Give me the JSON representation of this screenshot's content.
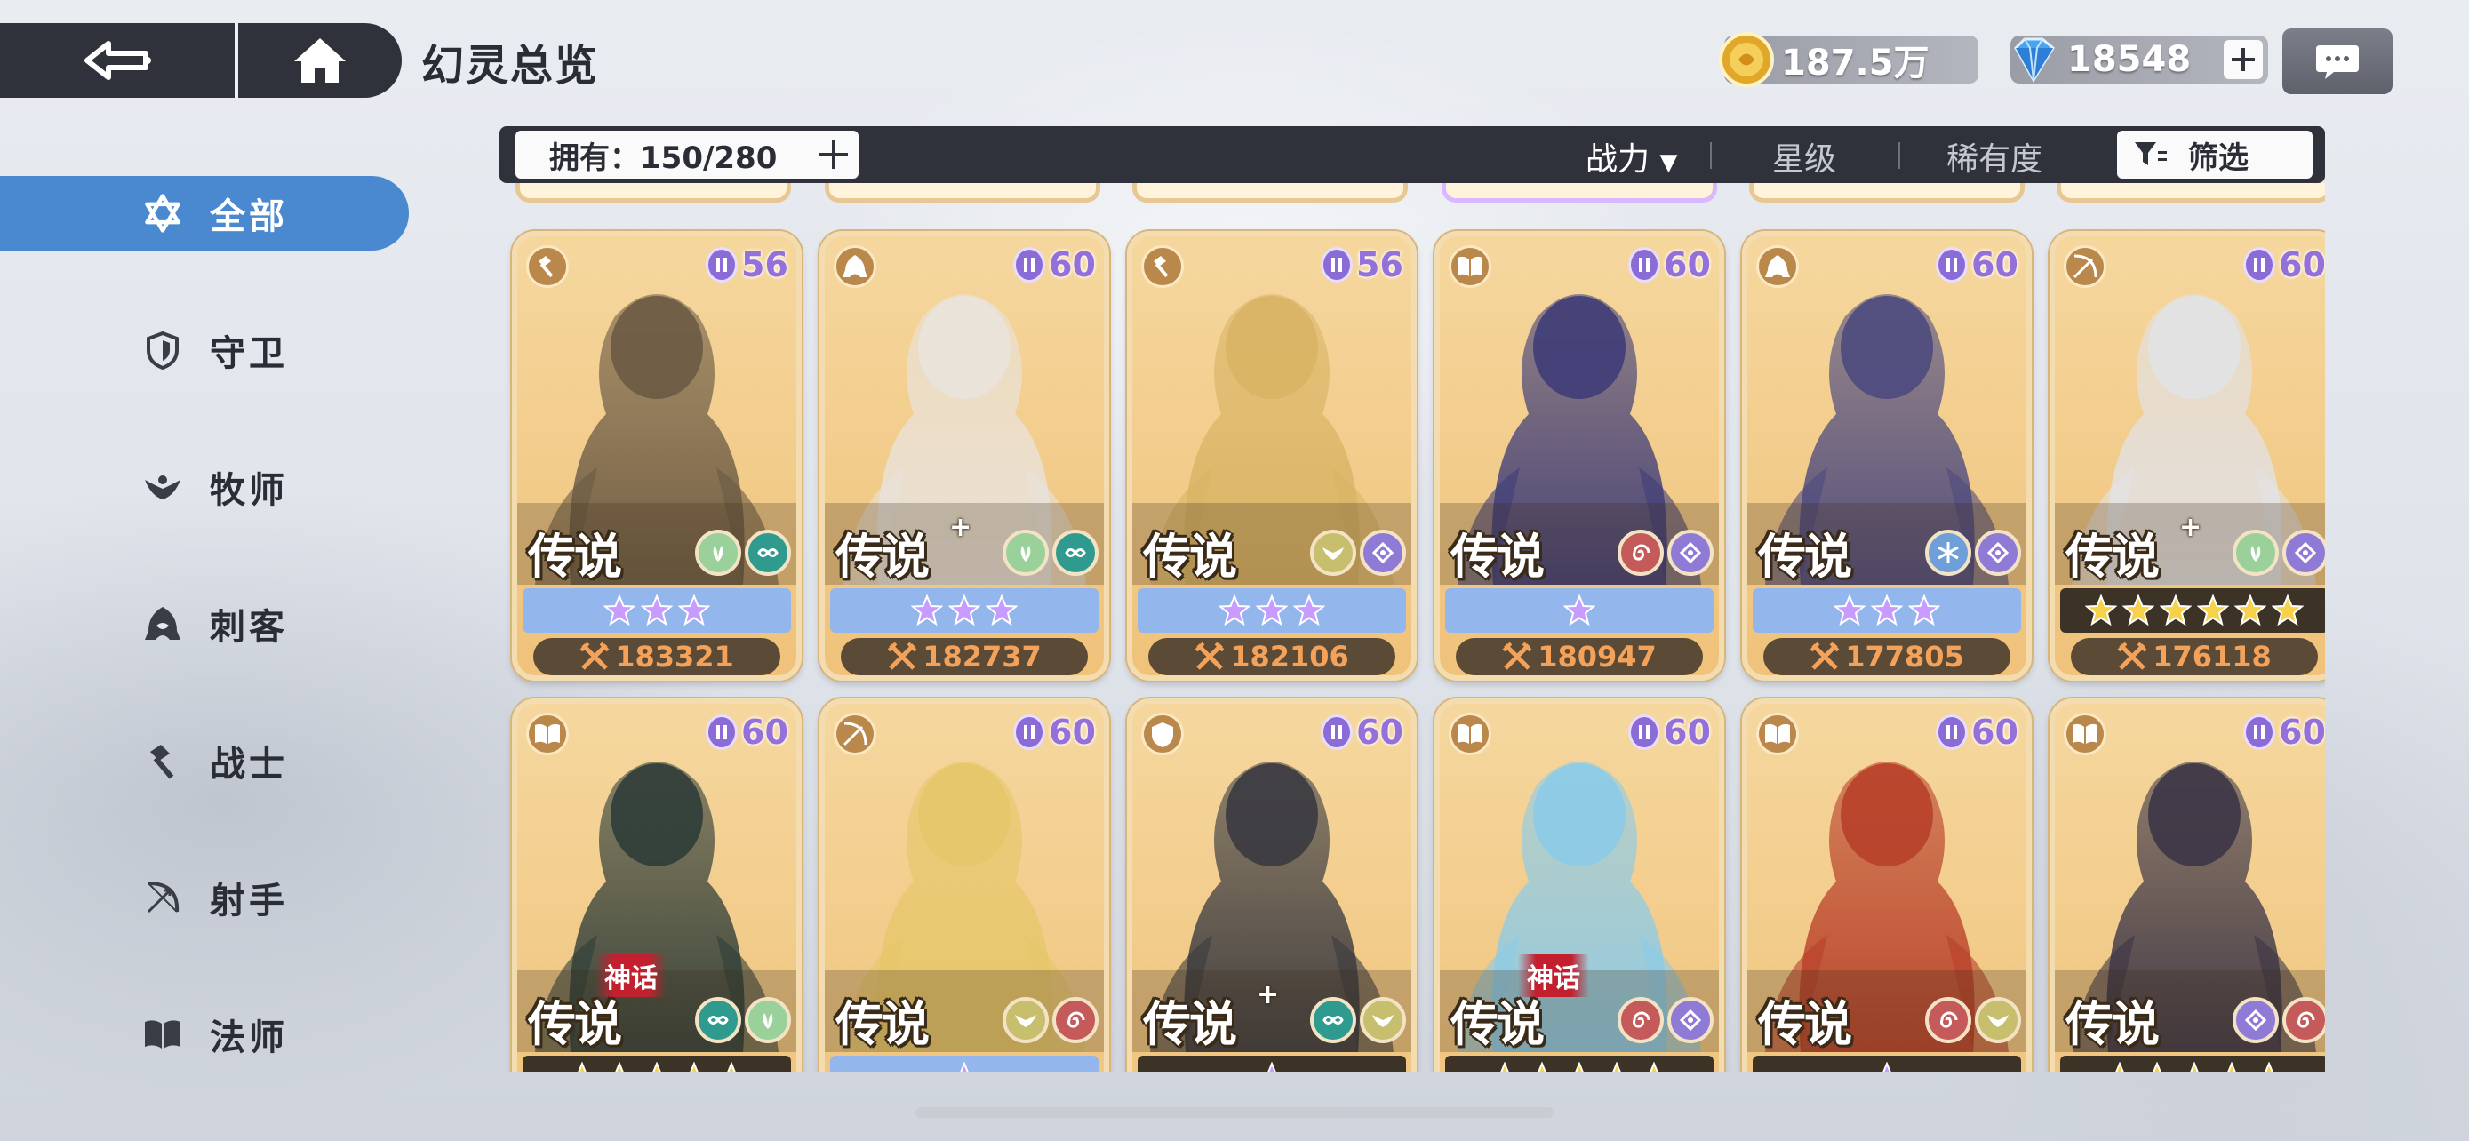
{
  "header": {
    "title": "幻灵总览",
    "back_icon": "back-arrow-icon",
    "home_icon": "home-icon"
  },
  "currency": {
    "gold": "187.5万",
    "gems": "18548"
  },
  "sidebar": {
    "items": [
      {
        "label": "全部",
        "icon": "star-of-david-icon",
        "active": true
      },
      {
        "label": "守卫",
        "icon": "shield-icon"
      },
      {
        "label": "牧师",
        "icon": "wings-icon"
      },
      {
        "label": "刺客",
        "icon": "hood-icon"
      },
      {
        "label": "战士",
        "icon": "hammer-icon"
      },
      {
        "label": "射手",
        "icon": "bow-icon"
      },
      {
        "label": "法师",
        "icon": "book-icon"
      }
    ]
  },
  "filter": {
    "owned": "拥有：150/280",
    "sort_power": "战力",
    "sort_star": "星级",
    "sort_rarity": "稀有度",
    "filter_label": "筛选"
  },
  "colors": {
    "accent_blue": "#4a89cf",
    "bar_dark": "#2f313b",
    "card_gold": "#f0c27a",
    "power_text": "#f4a25a",
    "level_purple": "#9470db"
  },
  "cards": [
    {
      "class": "warrior",
      "level": "56",
      "rarity": "传说",
      "plus": false,
      "myth": "",
      "elements": [
        "lotus",
        "infinity"
      ],
      "band": "blue",
      "stars": 3,
      "star_color": "purple",
      "power": "183321",
      "hue": "#6b5a44"
    },
    {
      "class": "assassin",
      "level": "60",
      "rarity": "传说",
      "plus": true,
      "myth": "",
      "elements": [
        "lotus",
        "infinity"
      ],
      "band": "blue",
      "stars": 3,
      "star_color": "purple",
      "power": "182737",
      "hue": "#e9e3dc"
    },
    {
      "class": "warrior",
      "level": "56",
      "rarity": "传说",
      "plus": false,
      "myth": "",
      "elements": [
        "wings",
        "eye"
      ],
      "band": "blue",
      "stars": 3,
      "star_color": "purple",
      "power": "182106",
      "hue": "#d9b465"
    },
    {
      "class": "mage",
      "level": "60",
      "rarity": "传说",
      "plus": false,
      "myth": "",
      "elements": [
        "spiral",
        "eye"
      ],
      "band": "blue",
      "stars": 1,
      "star_color": "purple",
      "power": "180947",
      "hue": "#3f3d78"
    },
    {
      "class": "assassin",
      "level": "60",
      "rarity": "传说",
      "plus": false,
      "myth": "",
      "elements": [
        "snowflake",
        "eye"
      ],
      "band": "blue",
      "stars": 3,
      "star_color": "purple",
      "power": "177805",
      "hue": "#4d4a7e"
    },
    {
      "class": "archer",
      "level": "60",
      "rarity": "传说",
      "plus": true,
      "myth": "",
      "elements": [
        "lotus",
        "eye"
      ],
      "band": "dark",
      "stars": 6,
      "star_color": "gold",
      "power": "176118",
      "hue": "#e2e2e6"
    },
    {
      "class": "mage",
      "level": "60",
      "rarity": "传说",
      "plus": false,
      "myth": "神话",
      "elements": [
        "infinity",
        "lotus"
      ],
      "band": "dark",
      "stars": 5,
      "star_color": "gold",
      "power": "",
      "hue": "#2f3d38"
    },
    {
      "class": "archer",
      "level": "60",
      "rarity": "传说",
      "plus": false,
      "myth": "",
      "elements": [
        "wings",
        "spiral"
      ],
      "band": "blue",
      "stars": 1,
      "star_color": "purple",
      "power": "",
      "hue": "#e6c76a"
    },
    {
      "class": "guardian",
      "level": "60",
      "rarity": "传说",
      "plus": true,
      "myth": "",
      "elements": [
        "infinity",
        "wings"
      ],
      "band": "dark",
      "stars": 1,
      "star_color": "purple",
      "power": "",
      "hue": "#3a3a40"
    },
    {
      "class": "mage",
      "level": "60",
      "rarity": "传说",
      "plus": false,
      "myth": "神话",
      "elements": [
        "spiral",
        "eye"
      ],
      "band": "dark",
      "stars": 5,
      "star_color": "gold",
      "power": "",
      "hue": "#8ccbe8"
    },
    {
      "class": "mage",
      "level": "60",
      "rarity": "传说",
      "plus": false,
      "myth": "",
      "elements": [
        "spiral",
        "wings"
      ],
      "band": "dark",
      "stars": 1,
      "star_color": "purple",
      "power": "",
      "hue": "#b8402a"
    },
    {
      "class": "mage",
      "level": "60",
      "rarity": "传说",
      "plus": false,
      "myth": "",
      "elements": [
        "eye",
        "spiral"
      ],
      "band": "dark",
      "stars": 5,
      "star_color": "gold",
      "power": "",
      "hue": "#3c3546"
    }
  ]
}
